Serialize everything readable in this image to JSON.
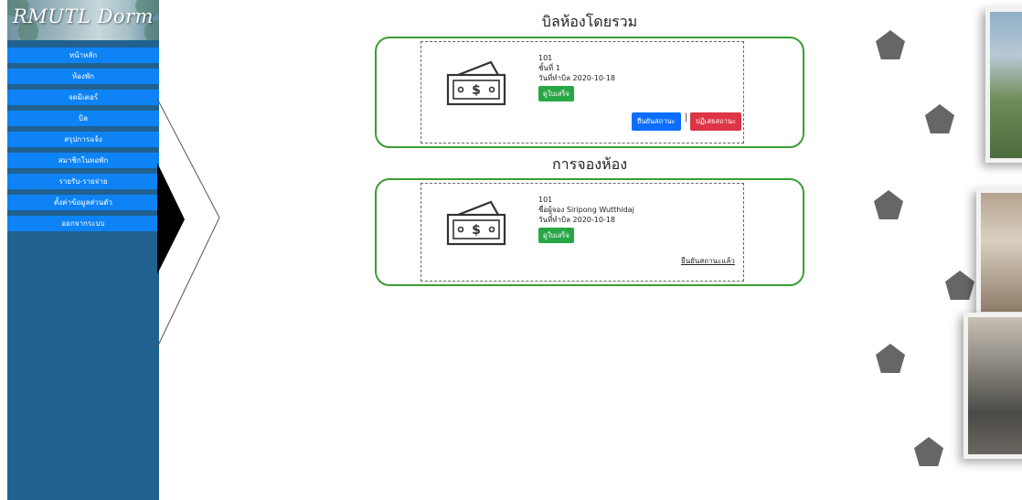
{
  "brand": {
    "logo_text": "RMUTL Dorm"
  },
  "sidebar": {
    "items": [
      {
        "label": "หน้าหลัก"
      },
      {
        "label": "ห้องพัก"
      },
      {
        "label": "จดมิเตอร์"
      },
      {
        "label": "บิล"
      },
      {
        "label": "สรุปการแจ้ง"
      },
      {
        "label": "สมาชิกในหอพัก"
      },
      {
        "label": "รายรับ-รายจ่าย"
      },
      {
        "label": "ตั้งค่าข้อมูลส่วนตัว"
      },
      {
        "label": "ออกจากระบบ"
      }
    ]
  },
  "bills": {
    "title": "บิลห้องโดยรวม",
    "card": {
      "room": "101",
      "floor": "ชั้นที่ 1",
      "bill_date": "วันที่ทำบิล 2020-10-18",
      "status_badge": "ดูใบเสร็จ",
      "confirm_label": "ยืนยันสถานะ",
      "separator": "|",
      "reject_label": "ปฏิเสธสถานะ"
    }
  },
  "booking": {
    "title": "การจองห้อง",
    "card": {
      "room": "101",
      "booker": "ชื่อผู้จอง Siripong Wutthidaj",
      "bill_date": "วันที่ทำบิล 2020-10-18",
      "status_badge": "ดูใบเสร็จ",
      "confirmed_label": "ยืนยันสถานะแล้ว"
    }
  },
  "colors": {
    "sidebar_bg": "#21618f",
    "nav_item": "#0d83f6",
    "card_border": "#3a9d32",
    "badge_green": "#28a745",
    "btn_blue": "#0d6efd",
    "btn_red": "#dc3545"
  }
}
